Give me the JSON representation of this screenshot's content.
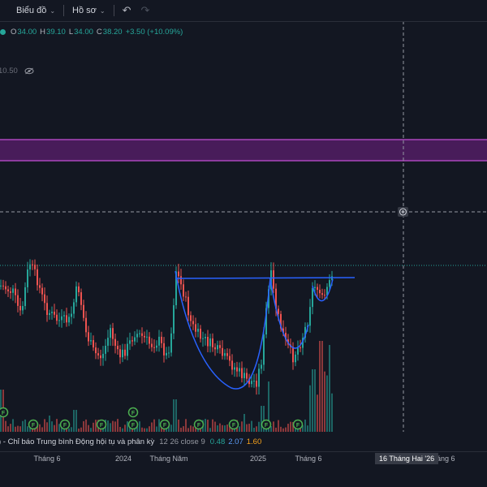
{
  "toolbar": {
    "chart_label": "Biểu đồ",
    "profile_label": "Hồ sơ",
    "undo_icon": "↶",
    "redo_icon": "↷"
  },
  "legend": {
    "o_key": "O",
    "o_val": "34.00",
    "h_key": "H",
    "h_val": "39.10",
    "l_key": "L",
    "l_val": "34.00",
    "c_key": "C",
    "c_val": "38.20",
    "change": "+3.50 (+10.09%)",
    "up_color": "#26a69a"
  },
  "volume_legend": {
    "value": "10.50"
  },
  "indicator": {
    "title": ") - Chỉ báo Trung bình Động hội tụ và phân kỳ",
    "params": "12 26 close 9",
    "macd": "0.48",
    "signal": "2.07",
    "hist": "1.60"
  },
  "time_axis": {
    "labels": [
      "Tháng 6",
      "2024",
      "Tháng Năm",
      "2025",
      "Tháng 6",
      "Tháng 6"
    ],
    "crosshair_date": "16 Tháng Hai '26"
  },
  "colors": {
    "background": "#131722",
    "up": "#26a69a",
    "down": "#ef5350",
    "trendline": "#2962ff",
    "zone": "#9c27b0"
  },
  "markers": {
    "label": "F"
  }
}
